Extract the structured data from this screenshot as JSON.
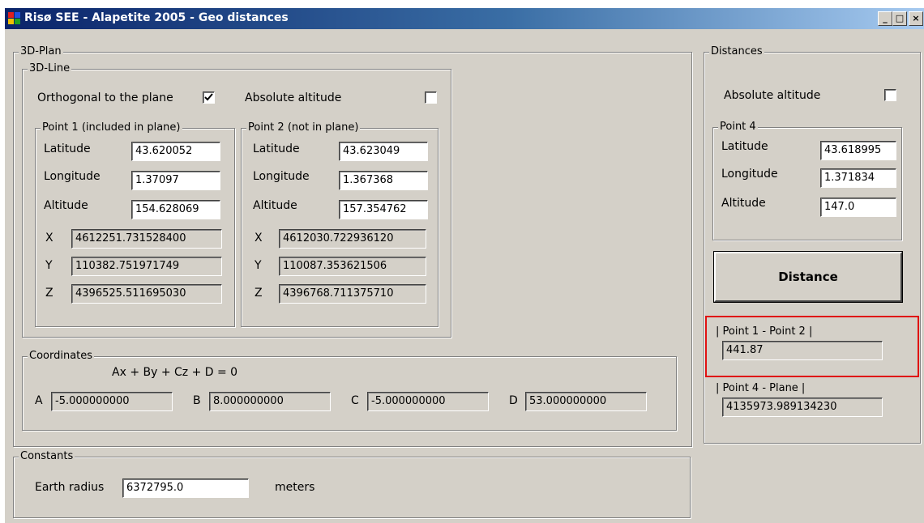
{
  "window": {
    "title": "Risø SEE - Alapetite 2005 - Geo distances",
    "min_label": "_",
    "max_label": "□",
    "close_label": "×"
  },
  "plan": {
    "legend": "3D-Plan",
    "line": {
      "legend": "3D-Line",
      "orthogonal_label": "Orthogonal to the plane",
      "orthogonal_checked": true,
      "absolute_altitude_label": "Absolute altitude",
      "absolute_altitude_checked": false,
      "point1": {
        "legend": "Point 1 (included in plane)",
        "lat_label": "Latitude",
        "lat": "43.620052",
        "lon_label": "Longitude",
        "lon": "1.37097",
        "alt_label": "Altitude",
        "alt": "154.628069",
        "x_label": "X",
        "x": "4612251.731528400",
        "y_label": "Y",
        "y": "110382.751971749",
        "z_label": "Z",
        "z": "4396525.511695030"
      },
      "point2": {
        "legend": "Point 2 (not in plane)",
        "lat_label": "Latitude",
        "lat": "43.623049",
        "lon_label": "Longitude",
        "lon": "1.367368",
        "alt_label": "Altitude",
        "alt": "157.354762",
        "x_label": "X",
        "x": "4612030.722936120",
        "y_label": "Y",
        "y": "110087.353621506",
        "z_label": "Z",
        "z": "4396768.711375710"
      }
    },
    "coords": {
      "legend": "Coordinates",
      "equation": "Ax + By + Cz + D = 0",
      "a_label": "A",
      "a": "-5.000000000",
      "b_label": "B",
      "b": "8.000000000",
      "c_label": "C",
      "c": "-5.000000000",
      "d_label": "D",
      "d": "53.000000000"
    }
  },
  "constants": {
    "legend": "Constants",
    "radius_label": "Earth radius",
    "radius": "6372795.0",
    "unit": "meters"
  },
  "distances": {
    "legend": "Distances",
    "absolute_altitude_label": "Absolute altitude",
    "absolute_altitude_checked": false,
    "point4": {
      "legend": "Point 4",
      "lat_label": "Latitude",
      "lat": "43.618995",
      "lon_label": "Longitude",
      "lon": "1.371834",
      "alt_label": "Altitude",
      "alt": "147.0"
    },
    "button": "Distance",
    "d12_label": "| Point 1 - Point 2 |",
    "d12": "441.87",
    "d4p_label": "| Point 4 - Plane |",
    "d4p": "4135973.989134230"
  },
  "colors": {
    "highlight": "#e01010",
    "titlebar": "#0a246a",
    "face": "#d4d0c8"
  }
}
